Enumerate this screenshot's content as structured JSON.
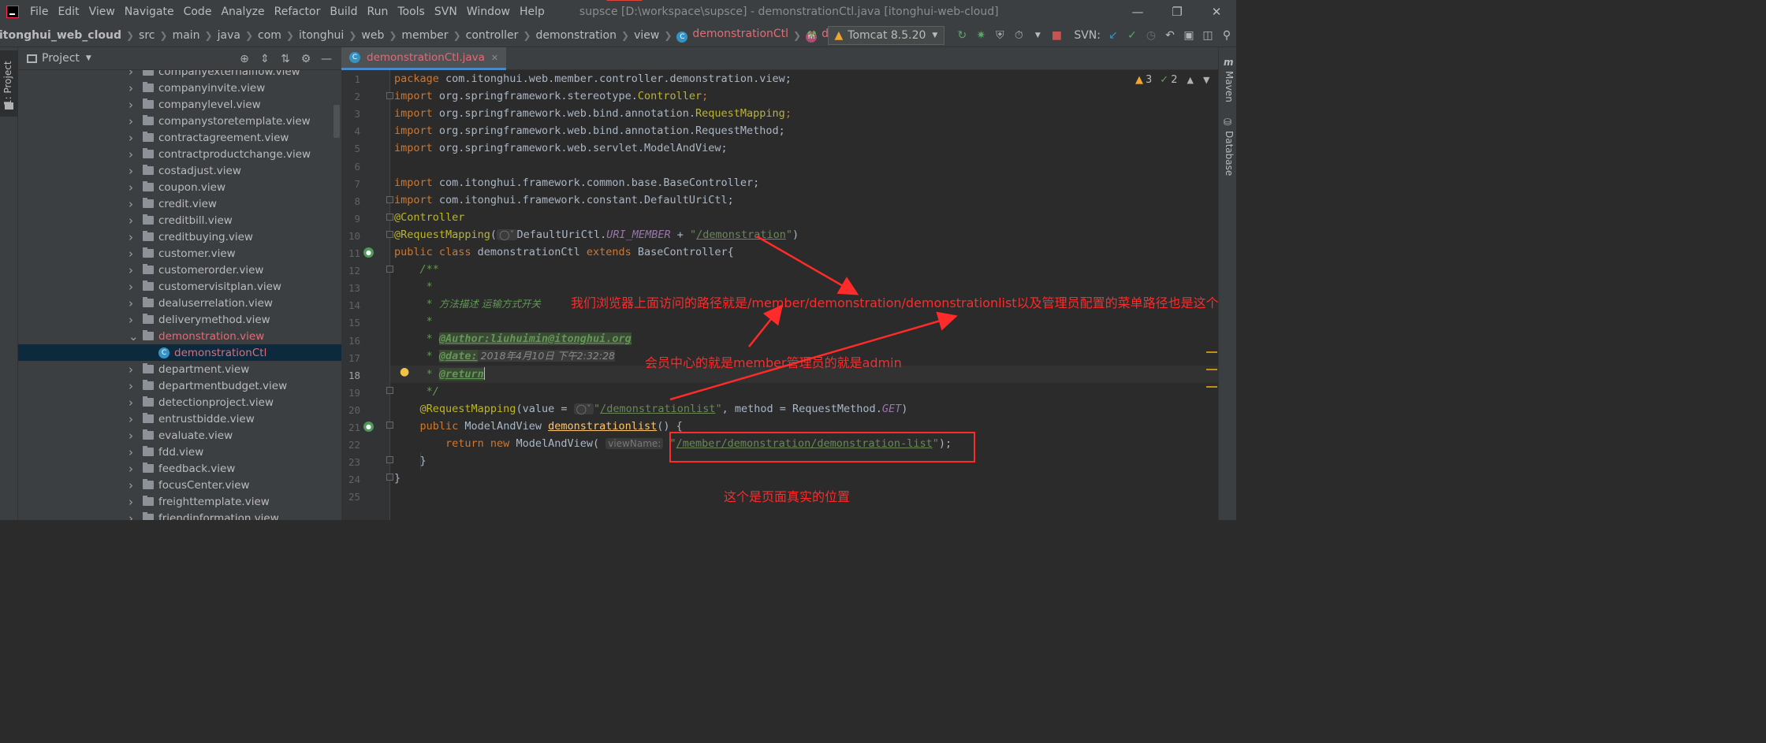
{
  "menu": [
    "File",
    "Edit",
    "View",
    "Navigate",
    "Code",
    "Analyze",
    "Refactor",
    "Build",
    "Run",
    "Tools",
    "SVN",
    "Window",
    "Help"
  ],
  "window_title": "supsce [D:\\workspace\\supsce] - demonstrationCtl.java [itonghui-web-cloud]",
  "breadcrumb": [
    "itonghui_web_cloud",
    "src",
    "main",
    "java",
    "com",
    "itonghui",
    "web",
    "member",
    "controller",
    "demonstration",
    "view",
    "demonstrationCtl",
    "demonstrationlist"
  ],
  "run_config": "Tomcat 8.5.20",
  "svn_label": "SVN:",
  "project_panel": {
    "strip_label": "1: Project",
    "title": "Project",
    "items": [
      {
        "label": "companyexternalflow.view",
        "type": "folder"
      },
      {
        "label": "companyinvite.view",
        "type": "folder"
      },
      {
        "label": "companylevel.view",
        "type": "folder"
      },
      {
        "label": "companystoretemplate.view",
        "type": "folder"
      },
      {
        "label": "contractagreement.view",
        "type": "folder"
      },
      {
        "label": "contractproductchange.view",
        "type": "folder"
      },
      {
        "label": "costadjust.view",
        "type": "folder"
      },
      {
        "label": "coupon.view",
        "type": "folder"
      },
      {
        "label": "credit.view",
        "type": "folder"
      },
      {
        "label": "creditbill.view",
        "type": "folder"
      },
      {
        "label": "creditbuying.view",
        "type": "folder"
      },
      {
        "label": "customer.view",
        "type": "folder"
      },
      {
        "label": "customerorder.view",
        "type": "folder"
      },
      {
        "label": "customervisitplan.view",
        "type": "folder"
      },
      {
        "label": "dealuserrelation.view",
        "type": "folder"
      },
      {
        "label": "deliverymethod.view",
        "type": "folder"
      },
      {
        "label": "demonstration.view",
        "type": "folder-open"
      },
      {
        "label": "demonstrationCtl",
        "type": "class"
      },
      {
        "label": "department.view",
        "type": "folder"
      },
      {
        "label": "departmentbudget.view",
        "type": "folder"
      },
      {
        "label": "detectionproject.view",
        "type": "folder"
      },
      {
        "label": "entrustbidde.view",
        "type": "folder"
      },
      {
        "label": "evaluate.view",
        "type": "folder"
      },
      {
        "label": "fdd.view",
        "type": "folder"
      },
      {
        "label": "feedback.view",
        "type": "folder"
      },
      {
        "label": "focusCenter.view",
        "type": "folder"
      },
      {
        "label": "freighttemplate.view",
        "type": "folder"
      },
      {
        "label": "friendinformation.view",
        "type": "folder"
      }
    ]
  },
  "editor": {
    "tab_label": "demonstrationCtl.java",
    "warnings": "3",
    "weak_warnings": "2",
    "line_numbers": [
      "1",
      "2",
      "3",
      "4",
      "5",
      "6",
      "7",
      "8",
      "9",
      "10",
      "11",
      "12",
      "13",
      "14",
      "15",
      "16",
      "17",
      "18",
      "19",
      "20",
      "21",
      "22",
      "23",
      "24",
      "25"
    ],
    "lines": {
      "l1": "com.itonghui.web.member.controller.demonstration.view;",
      "l2a": "org.springframework.stereotype.",
      "l2b": "Controller",
      "l3a": "org.springframework.web.bind.annotation.",
      "l3b": "RequestMapping",
      "l4": "org.springframework.web.bind.annotation.RequestMethod;",
      "l5": "org.springframework.web.servlet.ModelAndView;",
      "l7": "com.itonghui.framework.common.base.BaseController;",
      "l8": "com.itonghui.framework.constant.DefaultUriCtl;",
      "l9": "@Controller",
      "l10_ann": "@RequestMapping",
      "l10_cls": "DefaultUriCtl.",
      "l10_fld": "URI_MEMBER",
      "l10_str": "/demonstration",
      "l11_name": "demonstrationCtl",
      "l11_base": "BaseController{",
      "l14": "方法描述 运输方式开关",
      "l16": "@Author:liuhuimin@itonghui.org",
      "l17_tag": "@date:",
      "l17_val": " 2018年4月10日 下午2:32:28",
      "l18": "@return",
      "l20_ann": "@RequestMapping",
      "l20_str": "/demonstrationlist",
      "l20_enum": "GET",
      "l21_method": "demonstrationlist",
      "l22_hint": "viewName:",
      "l22_str": "/member/demonstration/demonstration-list"
    }
  },
  "right_tools": [
    "Maven",
    "Database"
  ],
  "annotations": {
    "a1": "我们浏览器上面访问的路径就是/member/demonstration/demonstrationlist以及管理员配置的菜单路径也是这个",
    "a2": "会员中心的就是member管理员的就是admin",
    "a3": "这个是页面真实的位置"
  },
  "colors": {
    "annotation": "#ff2a2a",
    "keyword": "#cc7832",
    "string": "#6a8759",
    "annotation_code": "#bbb529",
    "selected_file": "#e06c75"
  }
}
